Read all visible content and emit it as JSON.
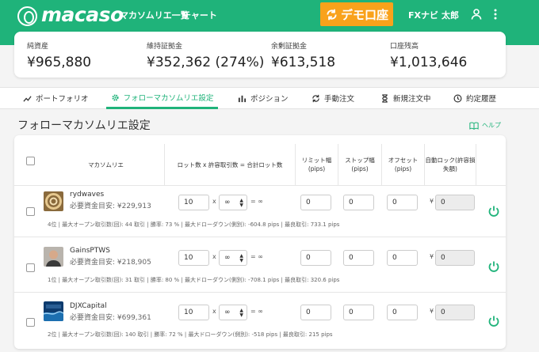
{
  "header": {
    "logo": "macaso",
    "nav": [
      "マカソムリエ一覧",
      "チャート"
    ],
    "demo_button": "デモ口座",
    "fx_navi": "FXナビ",
    "user": "太郎",
    "icons": [
      "user-icon",
      "kebab-menu-icon"
    ]
  },
  "summary": [
    {
      "label": "純資産",
      "value": "¥965,880"
    },
    {
      "label": "維持証拠金",
      "value": "¥352,362 (274%)"
    },
    {
      "label": "余剰証拠金",
      "value": "¥613,518"
    },
    {
      "label": "口座残高",
      "value": "¥1,013,646"
    }
  ],
  "tabs": [
    {
      "label": "ポートフォリオ",
      "icon": "trend-icon"
    },
    {
      "label": "フォローマカソムリエ設定",
      "icon": "gear-icon",
      "active": true
    },
    {
      "label": "ポジション",
      "icon": "bar-chart-icon"
    },
    {
      "label": "手動注文",
      "icon": "refresh-icon"
    },
    {
      "label": "新規注文中",
      "icon": "hourglass-icon"
    },
    {
      "label": "約定履歴",
      "icon": "clock-icon"
    }
  ],
  "page": {
    "title": "フォローマカソムリエ設定",
    "help": "ヘルプ"
  },
  "table": {
    "headers": {
      "sommelier": "マカソムリエ",
      "lots": "ロット数 x 許容取引数 = 合計ロット数",
      "limit": "リミット幅\n(pips)",
      "stop": "ストップ幅\n(pips)",
      "offset": "オフセット\n(pips)",
      "autolock": "自動ロック(許容損\n失額)"
    },
    "x_symbol": "x",
    "eq_symbol": "= ∞",
    "yen_symbol": "¥",
    "rows": [
      {
        "name": "rydwaves",
        "required": "必要資金目安: ¥229,913",
        "lot": "10",
        "allowed": "∞",
        "limit": "0",
        "stop": "0",
        "offset": "0",
        "autolock": "0",
        "stats": "4位 | 最大オープン取引数(回): 44 取引 | 勝率: 73 % | 最大ドローダウン(側別): -604.8 pips | 最良取引: 733.1 pips"
      },
      {
        "name": "GainsPTWS",
        "required": "必要資金目安: ¥218,905",
        "lot": "10",
        "allowed": "∞",
        "limit": "0",
        "stop": "0",
        "offset": "0",
        "autolock": "0",
        "stats": "1位 | 最大オープン取引数(回): 31 取引 | 勝率: 80 % | 最大ドローダウン(側別): -708.1 pips | 最良取引: 320.6 pips"
      },
      {
        "name": "DJXCapital",
        "required": "必要資金目安: ¥699,361",
        "lot": "10",
        "allowed": "∞",
        "limit": "0",
        "stop": "0",
        "offset": "0",
        "autolock": "0",
        "stats": "2位 | 最大オープン取引数(回): 140 取引 | 勝率: 72 % | 最大ドローダウン(側別): -518 pips | 最良取引: 215 pips"
      }
    ]
  },
  "colors": {
    "brand": "#1fb37a",
    "demo": "#f9a21b"
  }
}
